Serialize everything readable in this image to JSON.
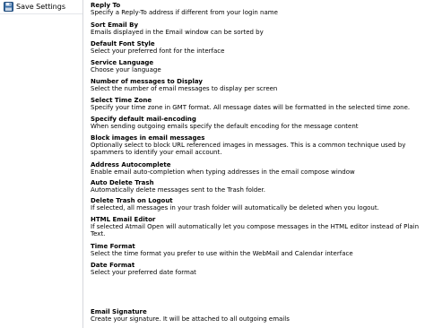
{
  "sidebar": {
    "save_label": "Save Settings",
    "save_icon": "floppy-disk-icon"
  },
  "settings": [
    {
      "title": "Reply To",
      "desc": "Specify a Reply-To address if different from your login name"
    },
    {
      "title": "Sort Email By",
      "desc": "Emails displayed in the Email window can be sorted by"
    },
    {
      "title": "Default Font Style",
      "desc": "Select your preferred font for the interface"
    },
    {
      "title": "Service Language",
      "desc": "Choose your language"
    },
    {
      "title": "Number of messages to Display",
      "desc": "Select the number of email messages to display per screen"
    },
    {
      "title": "Select Time Zone",
      "desc": "Specify your time zone in GMT format. All message dates will be formatted in the selected time zone."
    },
    {
      "title": "Specify default mail-encoding",
      "desc": "When sending outgoing emails specify the default encoding for the message content"
    },
    {
      "title": "Block images in email messages",
      "desc": "Optionally select to block URL referenced images in messages. This is a common technique used by\nspammers to identify your email account."
    },
    {
      "title": "Address Autocomplete",
      "desc": "Enable email auto-completion when typing addresses in the email compose window"
    },
    {
      "title": "Auto Delete Trash",
      "desc": "Automatically delete messages sent to the Trash folder."
    },
    {
      "title": "Delete Trash on Logout",
      "desc": "If selected, all messages in your trash folder will automatically be deleted when you logout."
    },
    {
      "title": "HTML Email Editor",
      "desc": "If selected Atmail Open will automatically let you compose messages in the HTML editor instead of Plain\nText."
    },
    {
      "title": "Time Format",
      "desc": "Select the time format you prefer to use within the WebMail and Calendar interface"
    },
    {
      "title": "Date Format",
      "desc": "Select your preferred date format"
    },
    {
      "title": "Email Signature",
      "desc": "Create your signature. It will be attached to all outgoing emails"
    }
  ]
}
